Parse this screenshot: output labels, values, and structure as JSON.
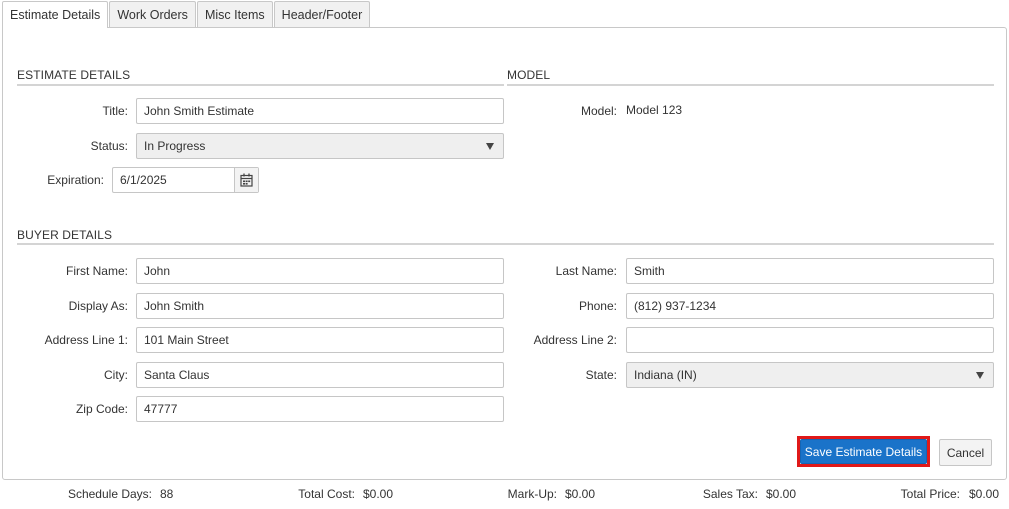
{
  "tabs": [
    {
      "label": "Estimate Details",
      "active": true
    },
    {
      "label": "Work Orders",
      "active": false
    },
    {
      "label": "Misc Items",
      "active": false
    },
    {
      "label": "Header/Footer",
      "active": false
    }
  ],
  "estimate_details": {
    "section_title": "ESTIMATE DETAILS",
    "title_label": "Title:",
    "title_value": "John Smith Estimate",
    "status_label": "Status:",
    "status_value": "In Progress",
    "expiration_label": "Expiration:",
    "expiration_value": "6/1/2025"
  },
  "model": {
    "section_title": "MODEL",
    "model_label": "Model:",
    "model_value": "Model 123"
  },
  "buyer_details": {
    "section_title": "BUYER DETAILS",
    "first_name_label": "First Name:",
    "first_name_value": "John",
    "last_name_label": "Last Name:",
    "last_name_value": "Smith",
    "display_as_label": "Display As:",
    "display_as_value": "John Smith",
    "phone_label": "Phone:",
    "phone_value": "(812) 937-1234",
    "address1_label": "Address Line 1:",
    "address1_value": "101 Main Street",
    "address2_label": "Address Line 2:",
    "address2_value": "",
    "city_label": "City:",
    "city_value": "Santa Claus",
    "state_label": "State:",
    "state_value": "Indiana (IN)",
    "zip_label": "Zip Code:",
    "zip_value": "47777"
  },
  "actions": {
    "save_label": "Save Estimate Details",
    "cancel_label": "Cancel"
  },
  "footer": {
    "schedule_days_label": "Schedule Days:",
    "schedule_days_value": "88",
    "total_cost_label": "Total Cost:",
    "total_cost_value": "$0.00",
    "markup_label": "Mark-Up:",
    "markup_value": "$0.00",
    "sales_tax_label": "Sales Tax:",
    "sales_tax_value": "$0.00",
    "total_price_label": "Total Price:",
    "total_price_value": "$0.00"
  },
  "icons": {
    "date_picker": "calendar-icon",
    "dropdown": "caret-down-icon"
  },
  "colors": {
    "primary_button": "#1a73c9",
    "focus_outline": "#e01919"
  }
}
